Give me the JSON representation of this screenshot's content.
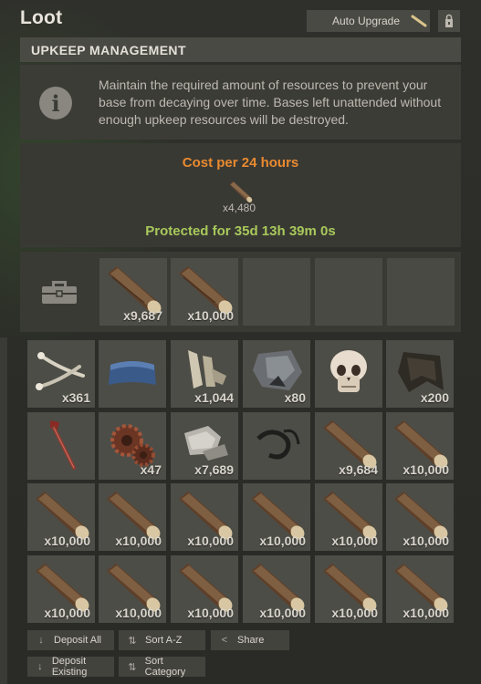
{
  "header": {
    "title": "Loot",
    "auto_upgrade_label": "Auto Upgrade"
  },
  "upkeep": {
    "section_title": "UPKEEP MANAGEMENT",
    "info_text": "Maintain the required amount of resources to prevent your base from decaying over time. Bases left unattended without enough upkeep resources will be destroyed.",
    "cost_title": "Cost per 24 hours",
    "cost_item_icon": "wood-icon",
    "cost_amount": "x4,480",
    "protected_text": "Protected for 35d 13h 39m 0s"
  },
  "tool_cupboard": {
    "icon": "toolbox-icon",
    "slots": [
      {
        "icon": "wood-icon",
        "amount": "x9,687"
      },
      {
        "icon": "wood-icon",
        "amount": "x10,000"
      },
      {
        "icon": "",
        "amount": ""
      },
      {
        "icon": "",
        "amount": ""
      },
      {
        "icon": "",
        "amount": ""
      }
    ]
  },
  "inventory": {
    "slots": [
      {
        "icon": "bone-tool-icon",
        "amount": "x361"
      },
      {
        "icon": "metal-plate-icon",
        "amount": ""
      },
      {
        "icon": "bone-fragments-icon",
        "amount": "x1,044"
      },
      {
        "icon": "metal-ore-icon",
        "amount": "x80"
      },
      {
        "icon": "skull-icon",
        "amount": ""
      },
      {
        "icon": "cloth-icon",
        "amount": "x200"
      },
      {
        "icon": "pipe-wrench-icon",
        "amount": ""
      },
      {
        "icon": "gears-icon",
        "amount": "x47"
      },
      {
        "icon": "stones-icon",
        "amount": "x7,689"
      },
      {
        "icon": "rope-icon",
        "amount": ""
      },
      {
        "icon": "wood-icon",
        "amount": "x9,684"
      },
      {
        "icon": "wood-icon",
        "amount": "x10,000"
      },
      {
        "icon": "wood-icon",
        "amount": "x10,000"
      },
      {
        "icon": "wood-icon",
        "amount": "x10,000"
      },
      {
        "icon": "wood-icon",
        "amount": "x10,000"
      },
      {
        "icon": "wood-icon",
        "amount": "x10,000"
      },
      {
        "icon": "wood-icon",
        "amount": "x10,000"
      },
      {
        "icon": "wood-icon",
        "amount": "x10,000"
      },
      {
        "icon": "wood-icon",
        "amount": "x10,000"
      },
      {
        "icon": "wood-icon",
        "amount": "x10,000"
      },
      {
        "icon": "wood-icon",
        "amount": "x10,000"
      },
      {
        "icon": "wood-icon",
        "amount": "x10,000"
      },
      {
        "icon": "wood-icon",
        "amount": "x10,000"
      },
      {
        "icon": "wood-icon",
        "amount": "x10,000"
      }
    ]
  },
  "actions": {
    "deposit_all": "Deposit All",
    "sort_az": "Sort A-Z",
    "share": "Share",
    "deposit_existing": "Deposit Existing",
    "sort_category": "Sort Category"
  },
  "colors": {
    "cost_title": "#e88a2f",
    "protected": "#a8c95a",
    "panel": "#3c3c37",
    "slot": "#4d4d47"
  }
}
